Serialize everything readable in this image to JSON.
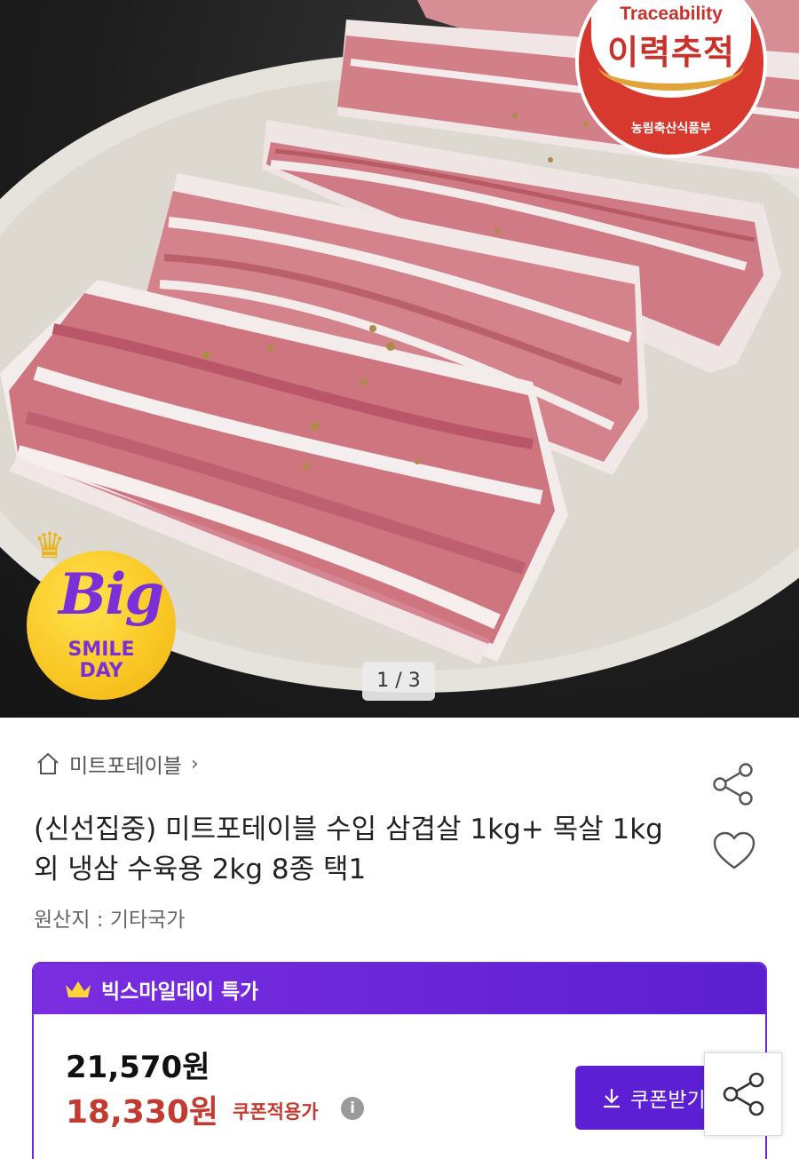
{
  "hero": {
    "counter": "1 / 3",
    "traceability_badge": {
      "english": "Traceability",
      "korean": "이력추적",
      "ministry": "농림축산식품부"
    },
    "promo_badge": {
      "big": "Big",
      "smile": "SMILE",
      "day": "DAY"
    }
  },
  "store": {
    "name": "미트포테이블"
  },
  "product": {
    "title": "(신선집중) 미트포테이블 수입 삼겹살 1kg+ 목살 1kg 외 냉삼 수육용 2kg 8종 택1",
    "origin": "원산지 : 기타국가"
  },
  "deal": {
    "label": "빅스마일데이 특가",
    "original_price": "21,570원",
    "sale_price": "18,330원",
    "coupon_price_label": "쿠폰적용가",
    "info_icon": "i",
    "coupon_button": "쿠폰받기"
  },
  "colors": {
    "deal_purple": "#6b2ad9",
    "sale_red": "#c33a30",
    "trace_red": "#d8392f",
    "promo_yellow": "#f9c623"
  }
}
